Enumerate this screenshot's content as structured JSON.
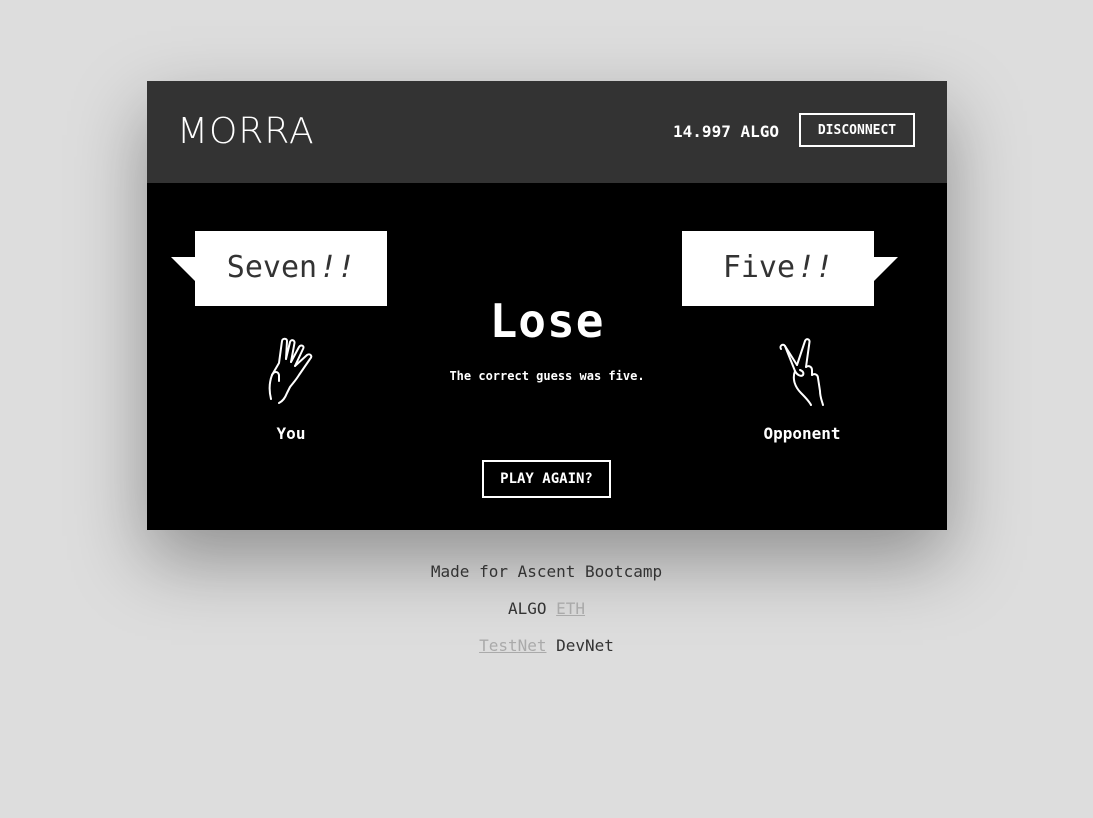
{
  "header": {
    "logo": "MORRA",
    "balance": "14.997 ALGO",
    "disconnect_label": "DISCONNECT"
  },
  "player": {
    "guess_word": "Seven",
    "guess_suffix": "!!",
    "label": "You",
    "hand_icon": "three-fingers-hand-icon"
  },
  "opponent": {
    "guess_word": "Five",
    "guess_suffix": "!!",
    "label": "Opponent",
    "hand_icon": "two-fingers-hand-icon"
  },
  "result": {
    "title": "Lose",
    "message_prefix": "The correct guess was ",
    "answer": "five",
    "message_suffix": ".",
    "play_again_label": "PLAY AGAIN?"
  },
  "footer": {
    "credit": "Made for Ascent Bootcamp",
    "chains": [
      {
        "label": "ALGO",
        "active": true
      },
      {
        "label": "ETH",
        "active": false
      }
    ],
    "networks": [
      {
        "label": "TestNet",
        "active": false
      },
      {
        "label": "DevNet",
        "active": true
      }
    ]
  },
  "colors": {
    "page_bg": "#dddddd",
    "header_bg": "#333333",
    "stage_bg": "#000000",
    "inactive_link": "#aaaaaa"
  }
}
